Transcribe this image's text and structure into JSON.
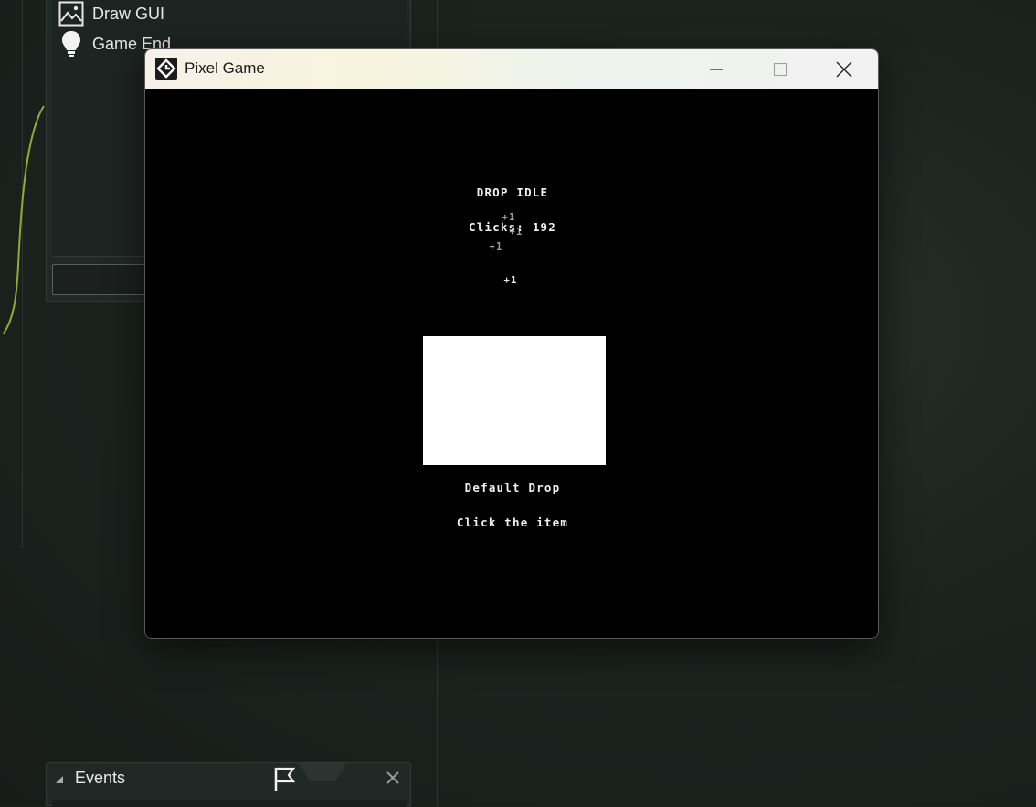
{
  "ide": {
    "items": [
      {
        "label": "Draw GUI",
        "icon": "image-icon"
      },
      {
        "label": "Game End",
        "icon": "lightbulb-icon"
      }
    ],
    "events_panel": {
      "title": "Events"
    }
  },
  "window": {
    "title": "Pixel Game",
    "controls": {
      "minimize": "minimize-icon",
      "maximize": "maximize-icon",
      "close": "close-icon"
    }
  },
  "game": {
    "status": "DROP IDLE",
    "clicks_label": "Clicks: 192",
    "floating_plus": [
      "+1",
      "+1",
      "+1",
      "+1"
    ],
    "drop_name": "Default Drop",
    "hint": "Click the item"
  }
}
